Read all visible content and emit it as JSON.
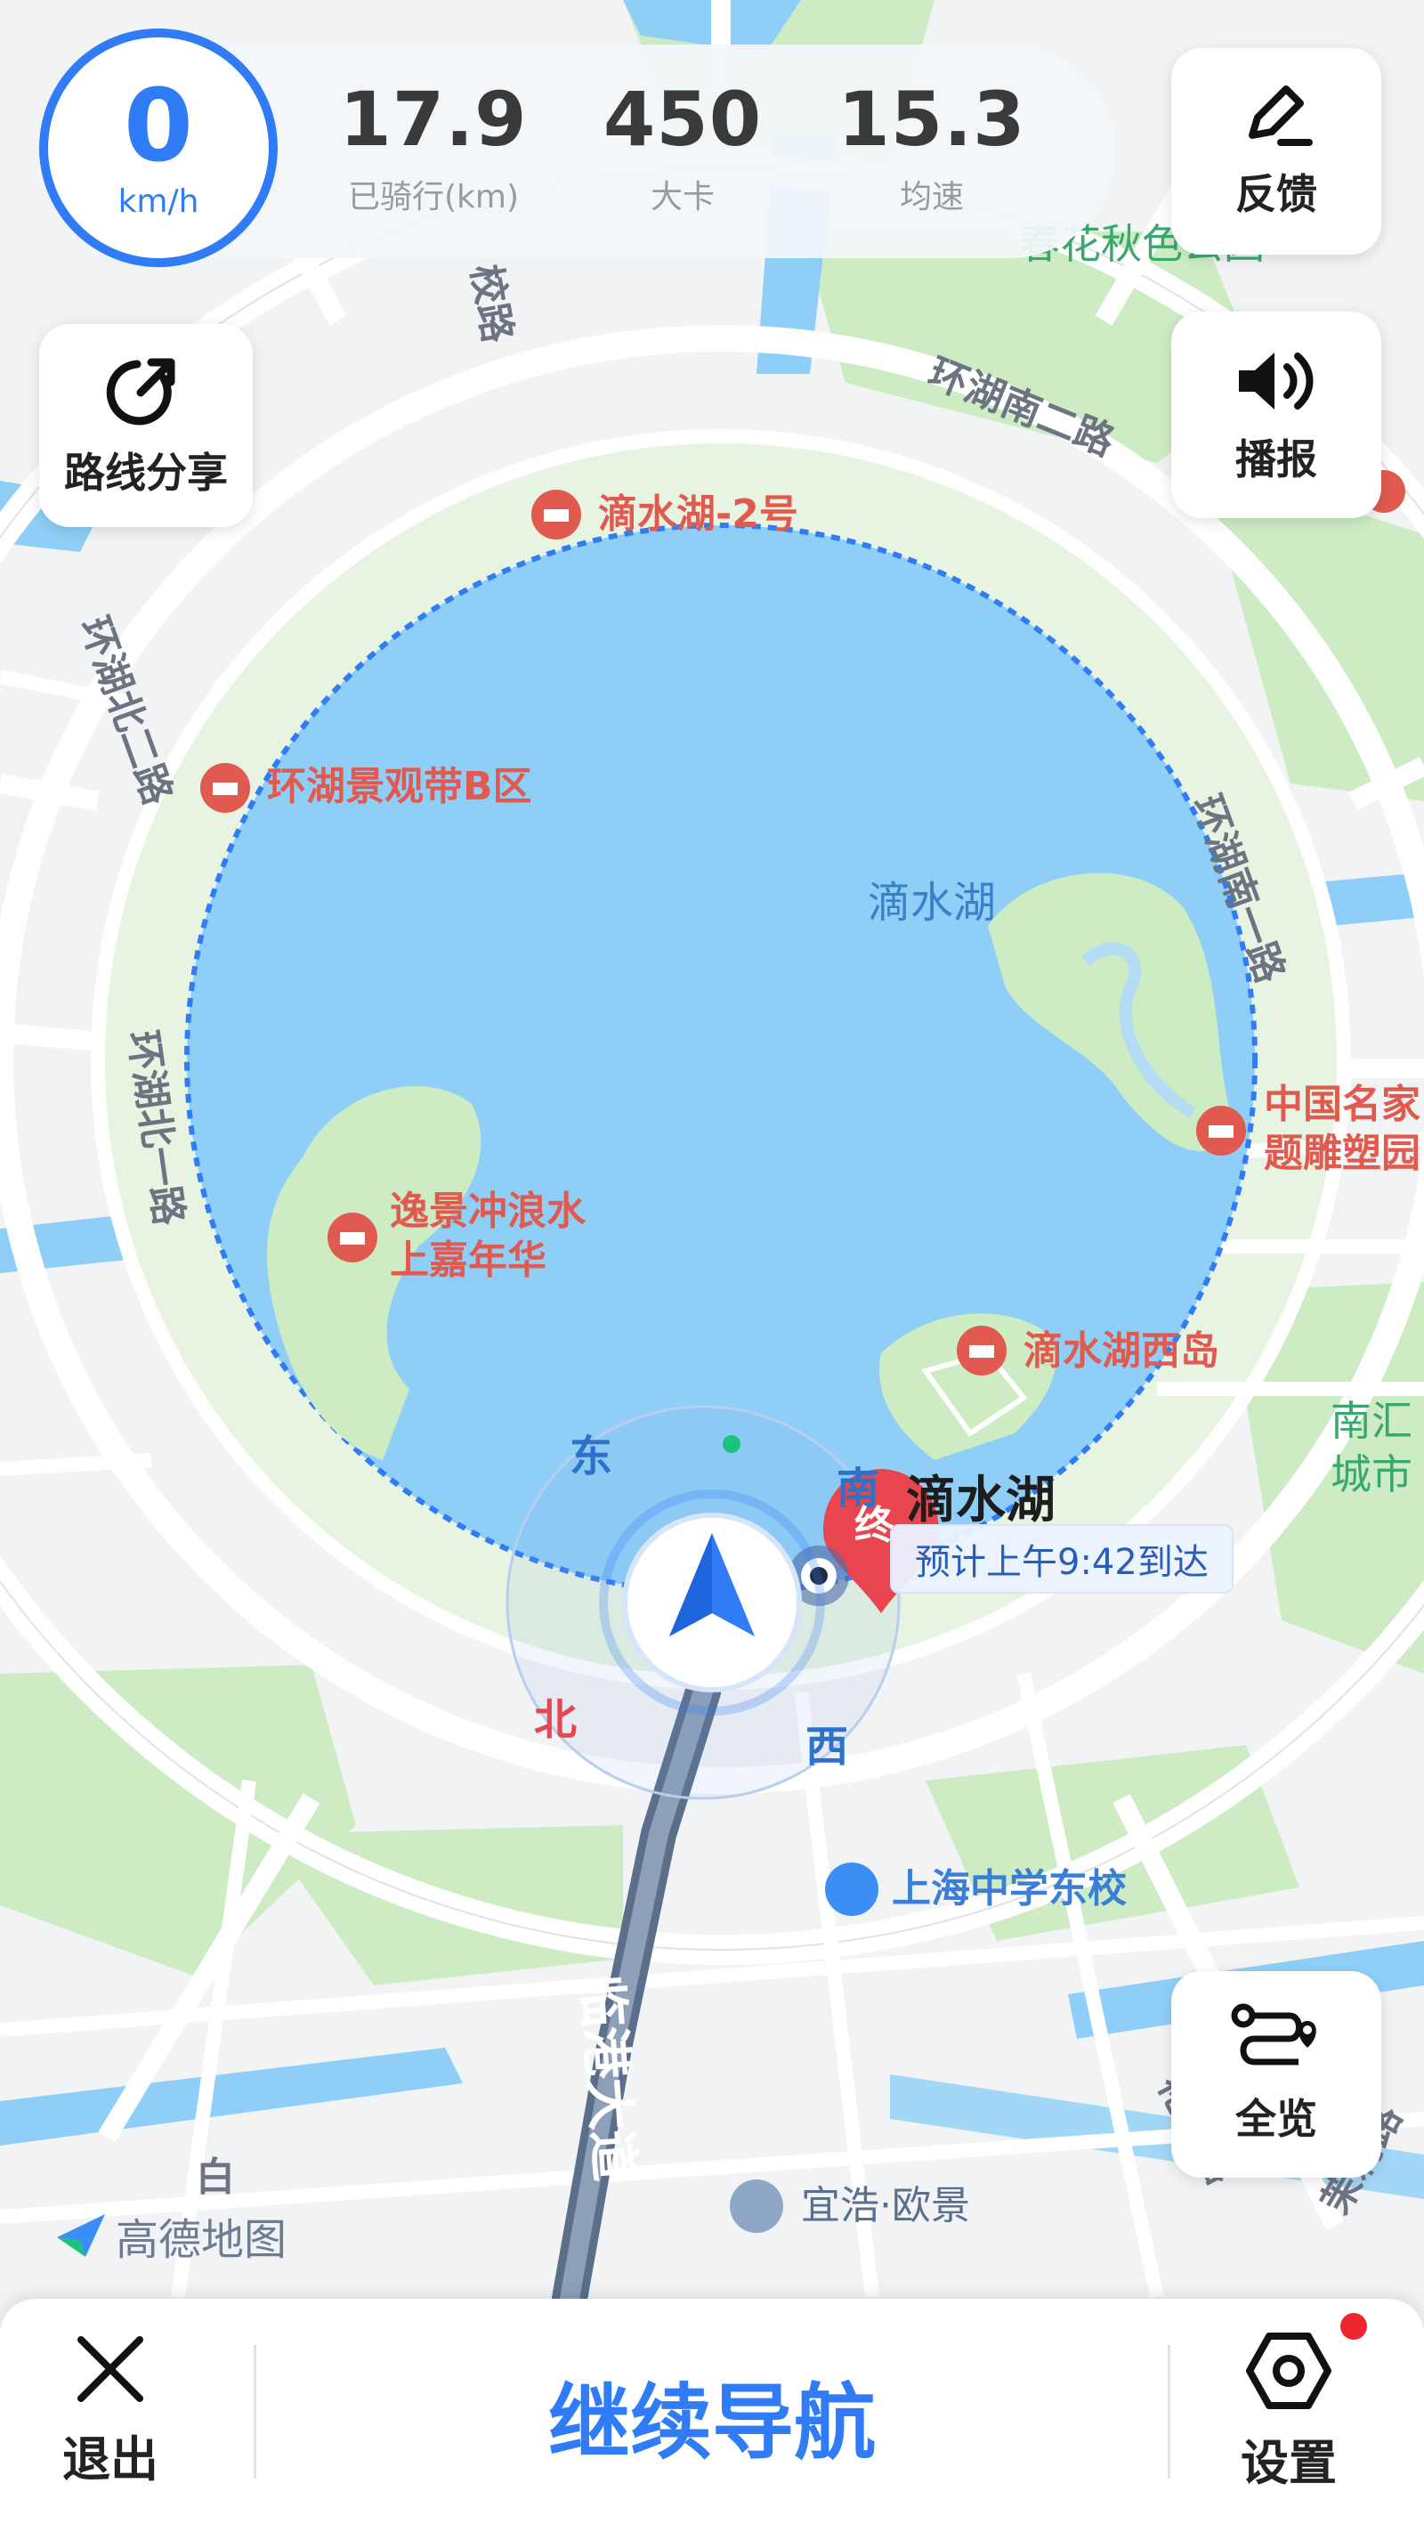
{
  "colors": {
    "accent": "#2f7cf6",
    "water": "#8fcff7",
    "park": "#cdecc4",
    "road": "#ffffff",
    "poi": "#e05a4f"
  },
  "speed": {
    "value": "0",
    "unit": "km/h"
  },
  "stats": [
    {
      "value": "17.9",
      "label": "已骑行(km)"
    },
    {
      "value": "450",
      "label": "大卡"
    },
    {
      "value": "15.3",
      "label": "均速"
    }
  ],
  "buttons": {
    "feedback": "反馈",
    "route_share": "路线分享",
    "broadcast": "播报",
    "overview": "全览"
  },
  "bottom": {
    "exit": "退出",
    "continue": "继续导航",
    "settings": "设置"
  },
  "compass": {
    "east": "东",
    "south": "南",
    "west": "西",
    "north": "北"
  },
  "destination": {
    "marker": "终",
    "name": "滴水湖",
    "eta": "预计上午9:42到达"
  },
  "map": {
    "lake_name": "滴水湖",
    "roads": [
      "环湖南二路",
      "环湖南一路",
      "环湖北二路",
      "环湖北一路",
      "临港大道",
      "花柏路",
      "茉莉路",
      "校路",
      "白"
    ],
    "pois": [
      {
        "name": "滴水湖-2号",
        "icon": "scenic-icon"
      },
      {
        "name": "环湖景观带B区",
        "icon": "scenic-icon"
      },
      {
        "name": "中国名家题雕塑园",
        "line1": "中国名家",
        "line2": "题雕塑园",
        "icon": "scenic-icon"
      },
      {
        "name": "逸景冲浪水上嘉年华",
        "line1": "逸景冲浪水",
        "line2": "上嘉年华",
        "icon": "scenic-icon"
      },
      {
        "name": "滴水湖西岛",
        "icon": "scenic-icon"
      },
      {
        "name": "上海中学东校",
        "icon": "school-icon"
      },
      {
        "name": "宜浩·欧景",
        "icon": "residence-icon"
      },
      {
        "name": "南汇城市",
        "line1": "南汇",
        "line2": "城市",
        "icon": "none"
      },
      {
        "name": "春花秋色公园",
        "icon": "none"
      }
    ],
    "provider": "高德地图"
  }
}
